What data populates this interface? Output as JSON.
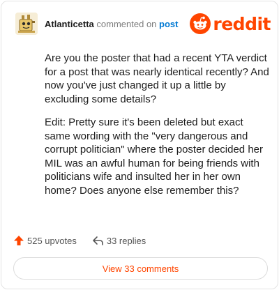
{
  "comment": {
    "username": "Atlanticetta",
    "action_text": "commented on",
    "post_link_label": "post",
    "avatar_icon": "snoo-avatar-icon",
    "paragraphs": [
      "Are you the poster that had a recent YTA verdict for a post that was nearly identical recently? And now you've just changed it up a little by excluding some details?",
      "Edit: Pretty sure it's been deleted but exact same wording with the \"very dangerous and corrupt politician\" where the poster decided her MIL was an awful human for being friends with politicians wife and insulted her in her own home? Does anyone else remember this?"
    ]
  },
  "brand": {
    "logo_text": "reddit",
    "logo_icon": "reddit-snoo-icon",
    "accent_color": "#ff4500"
  },
  "actions": {
    "upvotes_label": "525 upvotes",
    "upvote_icon": "upvote-arrow-icon",
    "replies_label": "33 replies",
    "reply_icon": "reply-arrow-icon"
  },
  "view_comments_label": "View 33 comments"
}
